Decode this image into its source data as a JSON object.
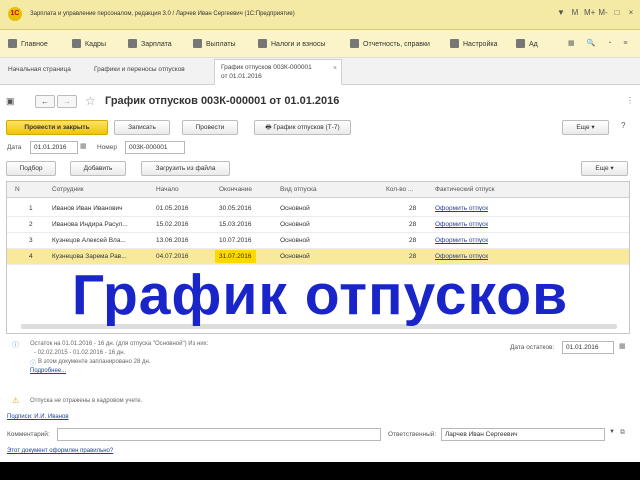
{
  "window": {
    "title": "Зарплата и управление персоналом, редакция 3.0 / Ларчев Иван Сергеевич (1С:Предприятие)",
    "logo_text": "1С",
    "controls": [
      "▼",
      "M",
      "M+",
      "M-",
      "□",
      "×"
    ]
  },
  "sections": [
    {
      "label": "Главное",
      "icon": "menu-icon"
    },
    {
      "label": "Кадры",
      "icon": "people-icon"
    },
    {
      "label": "Зарплата",
      "icon": "salary-icon"
    },
    {
      "label": "Выплаты",
      "icon": "payment-icon"
    },
    {
      "label": "Налоги и взносы",
      "icon": "percent-icon"
    },
    {
      "label": "Отчетность, справки",
      "icon": "reports-icon"
    },
    {
      "label": "Настройка",
      "icon": "settings-icon"
    },
    {
      "label": "Ад",
      "icon": "gear-icon"
    }
  ],
  "tabs": [
    {
      "label": "Начальная страница"
    },
    {
      "label": "Графики и переносы отпусков"
    },
    {
      "label": "График отпусков 003К-000001 от 01.01.2016",
      "line1": "График отпусков 003К-000001",
      "line2": "от 01.01.2016",
      "close": "×"
    }
  ],
  "form": {
    "title": "График отпусков 003К-000001 от 01.01.2016",
    "post_close": "Провести и закрыть",
    "save": "Записать",
    "post": "Провести",
    "print_t7": "График отпусков (Т-7)",
    "more": "Еще",
    "date_label": "Дата",
    "date_value": "01.01.2016",
    "number_label": "Номер",
    "number_value": "003К-000001",
    "pick": "Подбор",
    "add": "Добавить",
    "load_file": "Загрузить из файла",
    "more2": "Еще"
  },
  "table": {
    "columns": [
      "N",
      "Сотрудник",
      "Начало",
      "Окончание",
      "Вид отпуска",
      "Кол-во ...",
      "Фактический отпуск"
    ],
    "rows": [
      {
        "n": "1",
        "employee": "Иванов Иван Иванович",
        "start": "01.05.2016",
        "end": "30.05.2016",
        "type": "Основной",
        "days": "28",
        "actual": "Оформить отпуск"
      },
      {
        "n": "2",
        "employee": "Иванова Индира Расул...",
        "start": "15.02.2016",
        "end": "15.03.2016",
        "type": "Основной",
        "days": "28",
        "actual": "Оформить отпуск"
      },
      {
        "n": "3",
        "employee": "Кузнецов Алексей Вла...",
        "start": "13.06.2016",
        "end": "10.07.2016",
        "type": "Основной",
        "days": "28",
        "actual": "Оформить отпуск"
      },
      {
        "n": "4",
        "employee": "Кузнецова Зарема Рав...",
        "start": "04.07.2016",
        "end": "31.07.2016",
        "type": "Основной",
        "days": "28",
        "actual": "Оформить отпуск"
      }
    ]
  },
  "overlay_text": "График отпусков",
  "bottom": {
    "info1": "Остаток на 01.01.2016 - 16 дн. (для отпуска \"Основной\") Из них:",
    "info2": "- 02.02.2015 - 01.02.2016 - 16 дн.",
    "info3": "В этом документе запланировано 28 дн.",
    "more_link": "Подробнее...",
    "balance_label": "Дата остатков:",
    "balance_value": "01.01.2016",
    "warning": "Отпуска не отражены в кадровом учете.",
    "signatures": "Подписи: И.И. Иванов",
    "comment_label": "Комментарий:",
    "responsible_label": "Ответственный:",
    "responsible_value": "Ларчев Иван Сергеевич",
    "check_link": "Этот документ оформлен правильно?"
  },
  "colors": {
    "accent_yellow": "#f2c400",
    "overlay_blue": "#1a25c9",
    "link": "#1f3f9f"
  }
}
